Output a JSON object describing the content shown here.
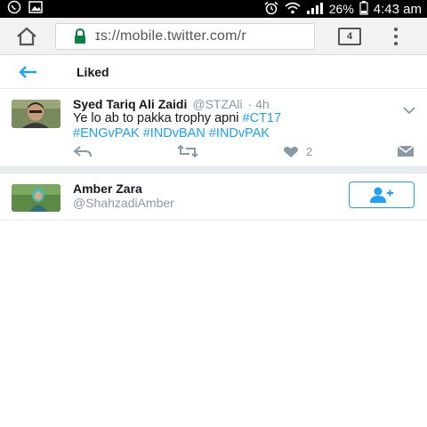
{
  "status_bar": {
    "battery": "26%",
    "time": "4:43 am"
  },
  "browser": {
    "url": "ɪs://mobile.twitter.com/r",
    "tab_count": "4"
  },
  "page": {
    "title": "Liked"
  },
  "tweet": {
    "name": "Syed Tariq Ali Zaidi",
    "handle": "@STZAli",
    "time": "· 4h",
    "text": "Ye lo ab to pakka trophy apni",
    "hashtags": [
      "#CT17",
      "#ENGvPAK",
      "#INDvBAN",
      "#INDvPAK"
    ],
    "like_count": "2"
  },
  "user": {
    "name": "Amber Zara",
    "handle": "@ShahzadiAmber"
  },
  "colors": {
    "accent": "#1da1f2",
    "muted": "#8899a6",
    "text": "#14171a"
  }
}
